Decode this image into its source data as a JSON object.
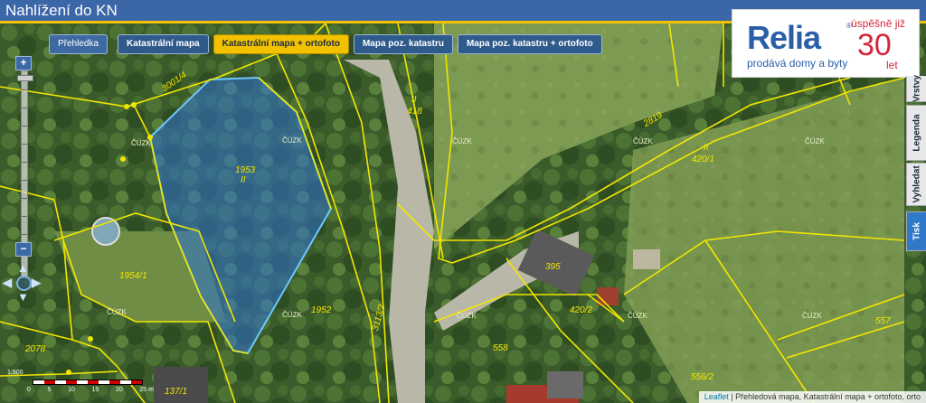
{
  "header": {
    "title": "Nahlížení do KN"
  },
  "layers": {
    "overview": "Přehledka",
    "cadastral_map": "Katastrální mapa",
    "cadastral_ortho": "Katastrální mapa + ortofoto",
    "map_poz": "Mapa poz. katastru",
    "map_poz_ortho": "Mapa poz. katastru + ortofoto"
  },
  "zoom": {
    "plus": "+",
    "minus": "−"
  },
  "ad": {
    "brand": "Relia",
    "registered": "®",
    "tagline": "prodává domy a byty",
    "success": "úspěšně již",
    "number": "30",
    "years": "let"
  },
  "side_tabs": [
    {
      "label": "Vrstvy"
    },
    {
      "label": "Legenda"
    },
    {
      "label": "Vyhledat"
    },
    {
      "label": "Tisk"
    }
  ],
  "parcels": [
    {
      "num": "3001/4"
    },
    {
      "num": "1953"
    },
    {
      "num": "418"
    },
    {
      "num": "2819"
    },
    {
      "num": "420/1"
    },
    {
      "num": "1954/1"
    },
    {
      "num": "1952"
    },
    {
      "num": "395"
    },
    {
      "num": "420/2"
    },
    {
      "num": "2078"
    },
    {
      "num": "558"
    },
    {
      "num": "557"
    },
    {
      "num": "556/2"
    },
    {
      "num": "137/1"
    },
    {
      "num": "3113/2"
    }
  ],
  "map_text": {
    "cuzk": "ČÚZK",
    "roman": "II"
  },
  "scale": {
    "ratio": "1:500",
    "ticks": [
      "0",
      "5",
      "10",
      "15",
      "20",
      "25 m"
    ]
  },
  "attribution": {
    "leaflet": "Leaflet",
    "text": " | Přehledová mapa, Katastrální mapa + ortofoto, orto"
  },
  "colors": {
    "header": "#3b66a8",
    "accent_yellow": "#f2c200",
    "boundary": "#f2e600",
    "selected_parcel": "#2f73d1",
    "relia_blue": "#2a5fa8",
    "relia_red": "#d6263b"
  }
}
